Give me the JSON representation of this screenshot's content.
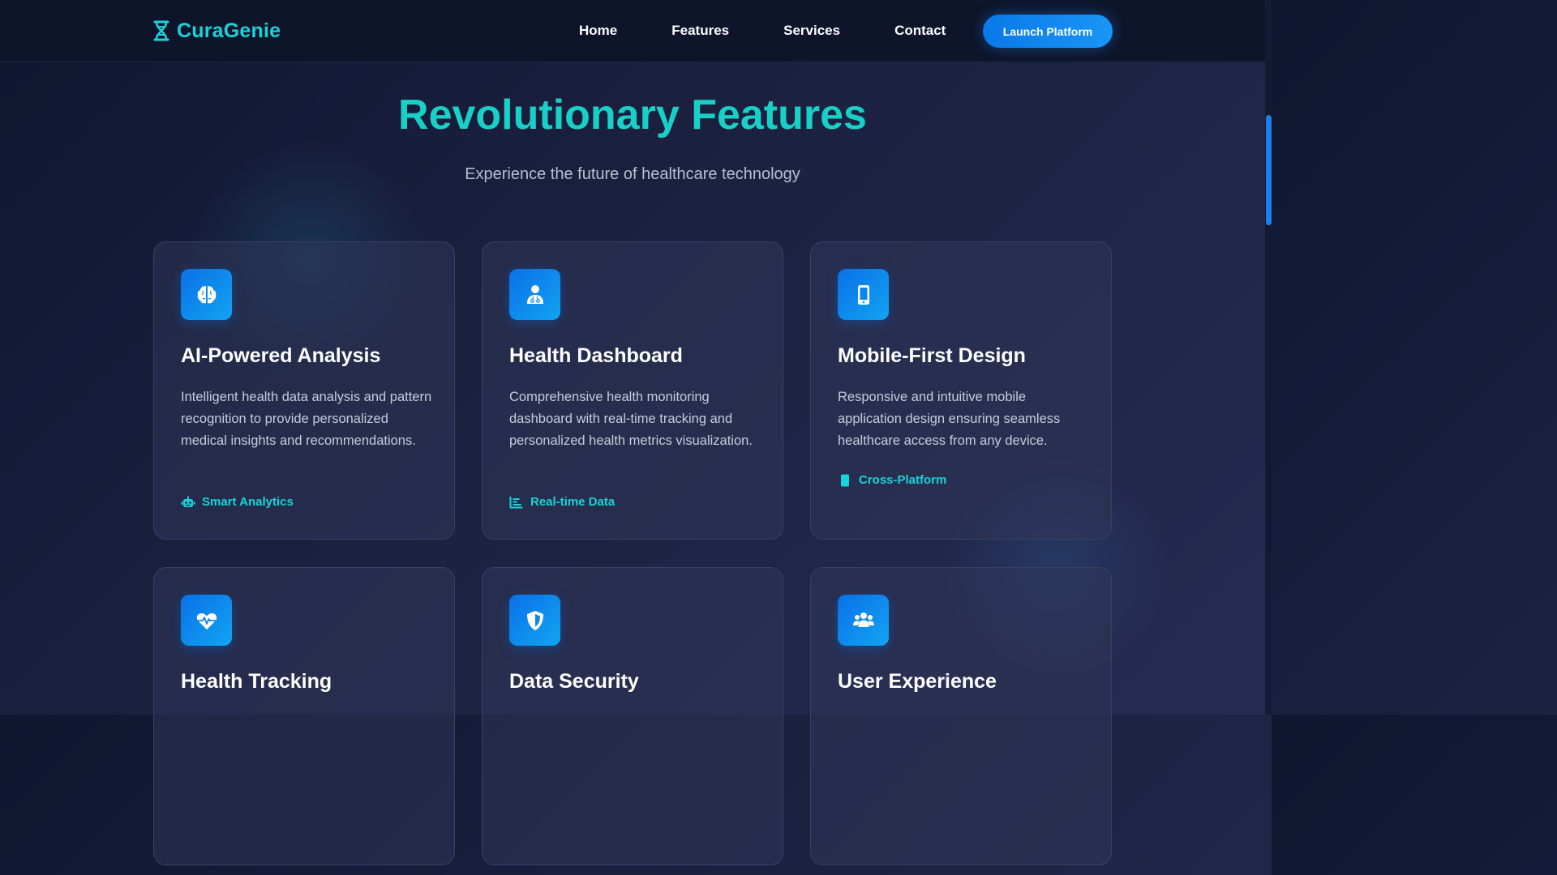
{
  "header": {
    "logo_text": "CuraGenie",
    "logo_icon": "dna-icon",
    "nav": [
      {
        "label": "Home"
      },
      {
        "label": "Features"
      },
      {
        "label": "Services"
      },
      {
        "label": "Contact"
      }
    ],
    "cta_label": "Launch Platform"
  },
  "hero": {
    "title": "Revolutionary Features",
    "subtitle": "Experience the future of healthcare technology"
  },
  "features": [
    {
      "icon": "brain-icon",
      "title": "AI-Powered Analysis",
      "description": "Intelligent health data analysis and pattern recognition to provide personalized medical insights and recommendations.",
      "tag_icon": "robot-icon",
      "tag": "Smart Analytics"
    },
    {
      "icon": "doctor-icon",
      "title": "Health Dashboard",
      "description": "Comprehensive health monitoring dashboard with real-time tracking and personalized health metrics visualization.",
      "tag_icon": "chart-icon",
      "tag": "Real-time Data"
    },
    {
      "icon": "mobile-icon",
      "title": "Mobile-First Design",
      "description": "Responsive and intuitive mobile application design ensuring seamless healthcare access from any device.",
      "tag_icon": "phone-icon",
      "tag": "Cross-Platform"
    },
    {
      "icon": "heart-pulse-icon",
      "title": "Health Tracking"
    },
    {
      "icon": "shield-icon",
      "title": "Data Security"
    },
    {
      "icon": "users-icon",
      "title": "User Experience"
    }
  ],
  "colors": {
    "accent_teal": "#19d3d9",
    "primary_blue": "#0a78ea",
    "background": "#1c2140"
  }
}
